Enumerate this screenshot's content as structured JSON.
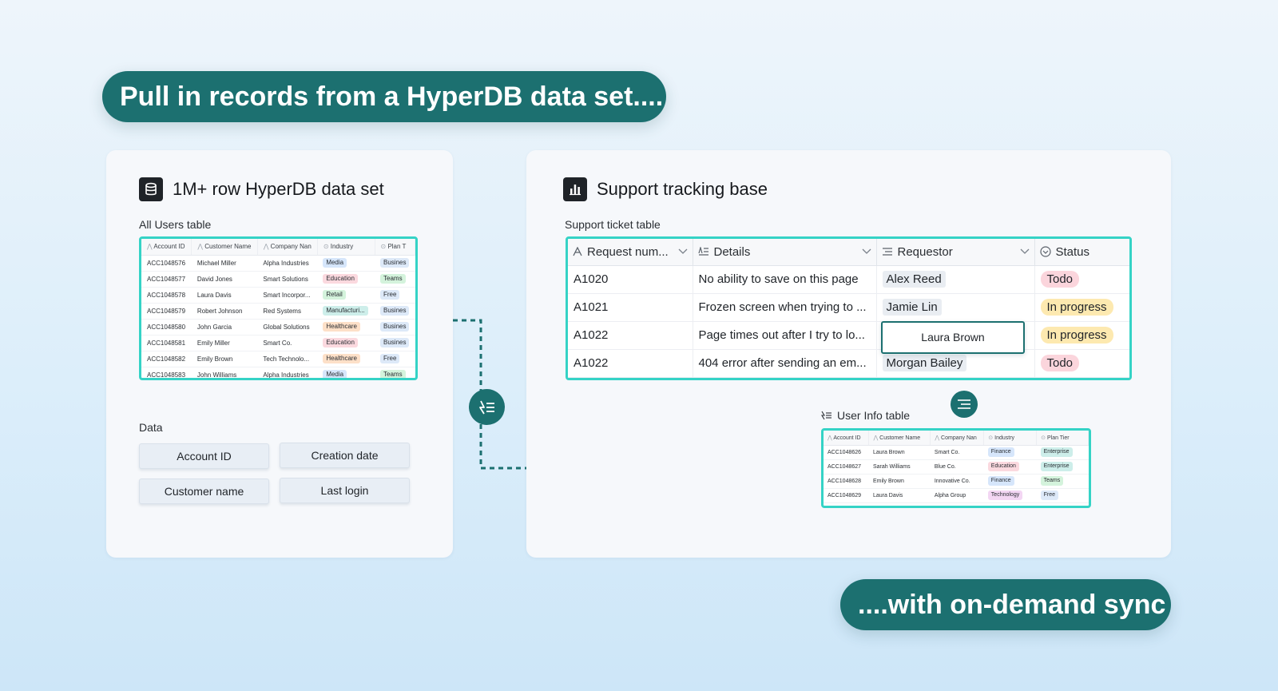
{
  "banner_top": "Pull in records from a HyperDB data set....",
  "banner_bottom": "....with on-demand sync",
  "left_card": {
    "title": "1M+ row HyperDB data set",
    "table_label": "All Users table",
    "headers": [
      "Account ID",
      "Customer Name",
      "Company Nan",
      "Industry",
      "Plan T"
    ],
    "rows": [
      {
        "id": "ACC1048576",
        "name": "Michael Miller",
        "company": "Alpha Industries",
        "industry": "Media",
        "plan": "Busines"
      },
      {
        "id": "ACC1048577",
        "name": "David Jones",
        "company": "Smart Solutions",
        "industry": "Education",
        "plan": "Teams"
      },
      {
        "id": "ACC1048578",
        "name": "Laura Davis",
        "company": "Smart Incorpor...",
        "industry": "Retail",
        "plan": "Free"
      },
      {
        "id": "ACC1048579",
        "name": "Robert Johnson",
        "company": "Red Systems",
        "industry": "Manufacturi...",
        "plan": "Busines"
      },
      {
        "id": "ACC1048580",
        "name": "John Garcia",
        "company": "Global Solutions",
        "industry": "Healthcare",
        "plan": "Busines"
      },
      {
        "id": "ACC1048581",
        "name": "Emily Miller",
        "company": "Smart Co.",
        "industry": "Education",
        "plan": "Busines"
      },
      {
        "id": "ACC1048582",
        "name": "Emily Brown",
        "company": "Tech Technolo...",
        "industry": "Healthcare",
        "plan": "Free"
      },
      {
        "id": "ACC1048583",
        "name": "John Williams",
        "company": "Alpha Industries",
        "industry": "Media",
        "plan": "Teams"
      }
    ],
    "data_label": "Data",
    "data_fields": [
      "Account ID",
      "Creation date",
      "Customer name",
      "Last login"
    ]
  },
  "right_card": {
    "title": "Support tracking base",
    "table_label": "Support ticket table",
    "headers": [
      "Request num...",
      "Details",
      "Requestor",
      "Status"
    ],
    "rows": [
      {
        "id": "A1020",
        "details": "No ability to save on this page",
        "requestor": "Alex Reed",
        "status": "Todo"
      },
      {
        "id": "A1021",
        "details": "Frozen screen when trying to ...",
        "requestor": "Jamie Lin",
        "status": "In progress"
      },
      {
        "id": "A1022",
        "details": "Page times out after I try to lo...",
        "requestor": "",
        "status": "In progress"
      },
      {
        "id": "A1022",
        "details": "404 error after sending an em...",
        "requestor": "Morgan Bailey",
        "status": "Todo"
      }
    ],
    "popup_value": "Laura Brown",
    "user_table_label": "User Info table",
    "user_headers": [
      "Account ID",
      "Customer Name",
      "Company Nan",
      "Industry",
      "Plan Tier"
    ],
    "user_rows": [
      {
        "id": "ACC1048626",
        "name": "Laura Brown",
        "company": "Smart Co.",
        "industry": "Finance",
        "plan": "Enterprise"
      },
      {
        "id": "ACC1048627",
        "name": "Sarah Williams",
        "company": "Blue Co.",
        "industry": "Education",
        "plan": "Enterprise"
      },
      {
        "id": "ACC1048628",
        "name": "Emily Brown",
        "company": "Innovative Co.",
        "industry": "Finance",
        "plan": "Teams"
      },
      {
        "id": "ACC1048629",
        "name": "Laura Davis",
        "company": "Alpha Group",
        "industry": "Technology",
        "plan": "Free"
      }
    ]
  },
  "colors": {
    "accent": "#1c7070",
    "highlight_border": "#35d3c6",
    "todo_bg": "#fbd5dc",
    "in_progress_bg": "#fde9b0"
  }
}
